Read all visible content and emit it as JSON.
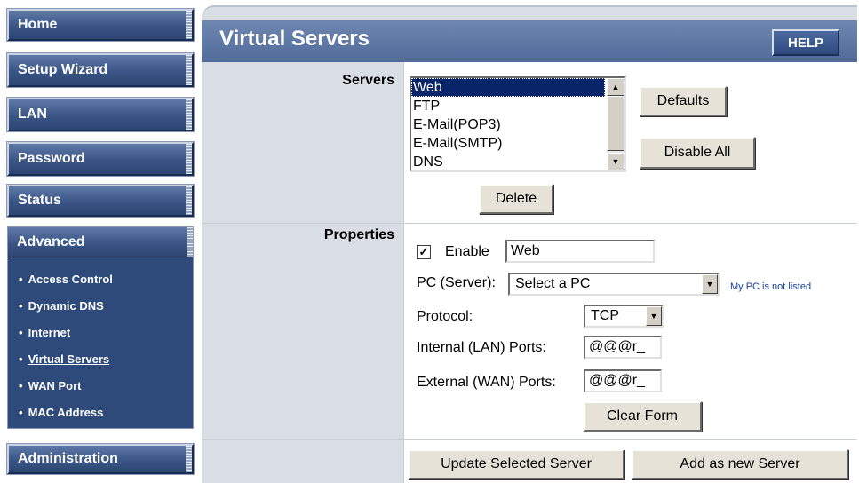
{
  "nav": {
    "home": "Home",
    "setup_wizard": "Setup Wizard",
    "lan": "LAN",
    "password": "Password",
    "status": "Status",
    "advanced": "Advanced",
    "administration": "Administration",
    "advanced_items": [
      {
        "label": "Access Control",
        "active": false
      },
      {
        "label": "Dynamic DNS",
        "active": false
      },
      {
        "label": "Internet",
        "active": false
      },
      {
        "label": "Virtual Servers",
        "active": true
      },
      {
        "label": "WAN Port",
        "active": false
      },
      {
        "label": "MAC Address",
        "active": false
      }
    ]
  },
  "page": {
    "title": "Virtual Servers",
    "help": "HELP"
  },
  "servers": {
    "label": "Servers",
    "options": [
      "Web",
      "FTP",
      "E-Mail(POP3)",
      "E-Mail(SMTP)",
      "DNS"
    ],
    "selected": "Web",
    "defaults_button": "Defaults",
    "disable_all_button": "Disable All",
    "delete_button": "Delete"
  },
  "properties": {
    "label": "Properties",
    "enable_label": "Enable",
    "enable_checked": true,
    "name_value": "Web",
    "pc_label": "PC (Server):",
    "pc_value": "Select a PC",
    "pc_not_listed_link": "My PC is not listed",
    "protocol_label": "Protocol:",
    "protocol_value": "TCP",
    "internal_ports_label": "Internal (LAN) Ports:",
    "internal_ports_value": "@@@r_",
    "external_ports_label": "External (WAN) Ports:",
    "external_ports_value": "@@@r_",
    "clear_form_button": "Clear Form"
  },
  "actions": {
    "update_button": "Update Selected Server",
    "add_button": "Add as new Server"
  },
  "colors": {
    "nav_button": "#3a5586",
    "title_bar": "#6f87b1",
    "label_column": "#d9dde4",
    "selection": "#0a246a",
    "link": "#1b3f9c"
  }
}
